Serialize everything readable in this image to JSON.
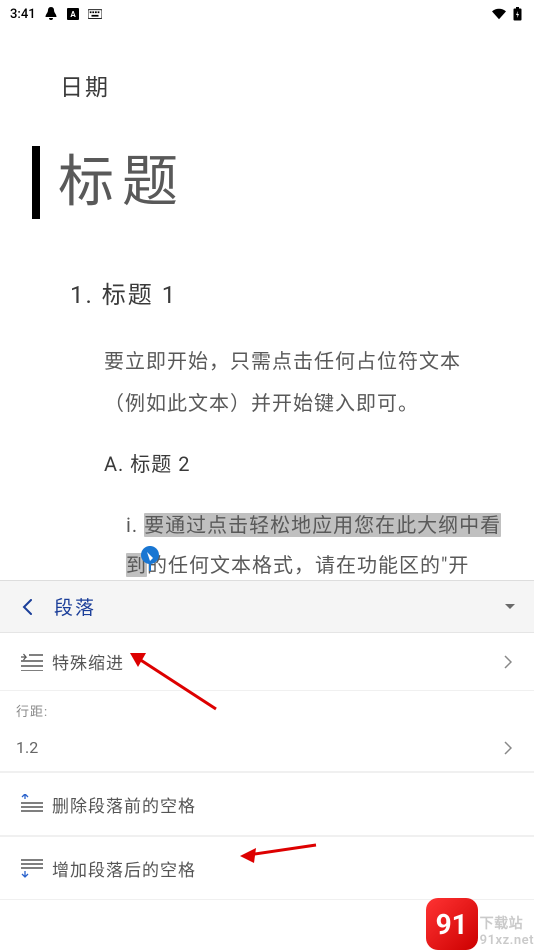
{
  "status": {
    "time": "3:41",
    "wifi": true,
    "battery": true
  },
  "document": {
    "date_label": "日期",
    "title": "标题",
    "h1": "1. 标题 1",
    "p1": "要立即开始，只需点击任何占位符文本（例如此文本）并开始键入即可。",
    "h2": "A. 标题 2",
    "p2_prefix": "i. ",
    "p2_line1": "要通过点击轻松地应用您在此大纲中看",
    "p2_line2_hl": "到",
    "p2_line2_rest": "的任何文本格式，请在功能区的\"开"
  },
  "panel": {
    "title": "段落",
    "rows": {
      "special_indent": "特殊缩进",
      "line_spacing_label": "行距:",
      "line_spacing_value": "1.2",
      "remove_space_before": "删除段落前的空格",
      "add_space_after": "增加段落后的空格"
    }
  },
  "watermark": {
    "logo_text": "91",
    "line1": "下载站",
    "line2": "91xz.net"
  },
  "colors": {
    "accent": "#1b3e99",
    "text_dark": "#3a3a3a",
    "text_med": "#595959",
    "highlight": "#c0c0c0"
  }
}
